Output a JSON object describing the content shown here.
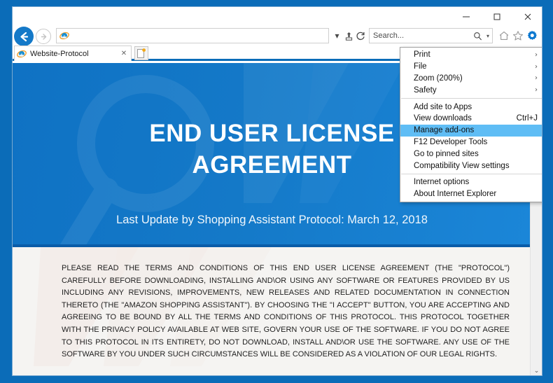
{
  "window": {
    "minimize_label": "–",
    "maximize_label": "□",
    "close_label": "✕"
  },
  "nav": {
    "back_label": "←",
    "forward_label": "→",
    "address_value": "",
    "address_dropdown_label": "▾",
    "compatibility_label": "⇧",
    "refresh_label": "↻",
    "home_icon": "home-icon",
    "favorites_icon": "star-icon",
    "tools_icon": "gear-icon",
    "feedback_icon": "smiley-icon"
  },
  "search": {
    "placeholder": "Search...",
    "value": "Search...",
    "icon": "magnifier-icon",
    "dropdown_label": "▾"
  },
  "tabs": {
    "active": {
      "title": "Website-Protocol",
      "favicon": "ie-logo-icon",
      "close_label": "✕"
    },
    "new_tab_label": "new-tab-icon"
  },
  "tools_menu": {
    "groups": [
      {
        "items": [
          {
            "label": "Print",
            "shortcut": "",
            "submenu": true,
            "highlight": false
          },
          {
            "label": "File",
            "shortcut": "",
            "submenu": true,
            "highlight": false
          },
          {
            "label": "Zoom (200%)",
            "shortcut": "",
            "submenu": true,
            "highlight": false
          },
          {
            "label": "Safety",
            "shortcut": "",
            "submenu": true,
            "highlight": false
          }
        ]
      },
      {
        "items": [
          {
            "label": "Add site to Apps",
            "shortcut": "",
            "submenu": false,
            "highlight": false
          },
          {
            "label": "View downloads",
            "shortcut": "Ctrl+J",
            "submenu": false,
            "highlight": false
          },
          {
            "label": "Manage add-ons",
            "shortcut": "",
            "submenu": false,
            "highlight": true
          },
          {
            "label": "F12 Developer Tools",
            "shortcut": "",
            "submenu": false,
            "highlight": false
          },
          {
            "label": "Go to pinned sites",
            "shortcut": "",
            "submenu": false,
            "highlight": false
          },
          {
            "label": "Compatibility View settings",
            "shortcut": "",
            "submenu": false,
            "highlight": false
          }
        ]
      },
      {
        "items": [
          {
            "label": "Internet options",
            "shortcut": "",
            "submenu": false,
            "highlight": false
          },
          {
            "label": "About Internet Explorer",
            "shortcut": "",
            "submenu": false,
            "highlight": false
          }
        ]
      }
    ]
  },
  "page": {
    "hero": {
      "title_line1": "END USER LICENSE",
      "title_line2": "AGREEMENT",
      "subtitle": "Last Update by Shopping Assistant Protocol: March 12, 2018"
    },
    "eula_body": "PLEASE READ THE TERMS AND CONDITIONS OF THIS END USER LICENSE AGREEMENT (THE \"PROTOCOL\") CAREFULLY BEFORE DOWNLOADING, INSTALLING AND\\OR USING ANY SOFTWARE OR FEATURES PROVIDED BY US INCLUDING ANY REVISIONS, IMPROVEMENTS, NEW RELEASES AND RELATED DOCUMENTATION IN CONNECTION THERETO (THE \"AMAZON SHOPPING ASSISTANT\"). BY CHOOSING THE \"I ACCEPT\" BUTTON, YOU ARE ACCEPTING AND AGREEING TO BE BOUND BY ALL THE TERMS AND CONDITIONS OF THIS PROTOCOL. THIS PROTOCOL TOGETHER WITH THE PRIVACY POLICY AVAILABLE AT WEB SITE, GOVERN YOUR USE OF THE SOFTWARE. IF YOU DO NOT AGREE TO THIS PROTOCOL IN ITS ENTIRETY, DO NOT DOWNLOAD, INSTALL AND\\OR USE THE SOFTWARE. ANY USE OF THE SOFTWARE BY YOU UNDER SUCH CIRCUMSTANCES WILL BE CONSIDERED AS A VIOLATION OF OUR LEGAL RIGHTS."
  },
  "scrollbar": {
    "up_label": "⌃",
    "down_label": "⌄"
  },
  "colors": {
    "window_frame": "#0b6cb8",
    "hero_blue": "#1479c8",
    "hero_band": "#0a5ca8",
    "menu_highlight": "#5fbdf5",
    "gear_active": "#0b78d0",
    "smiley_yellow": "#f5d32e"
  }
}
